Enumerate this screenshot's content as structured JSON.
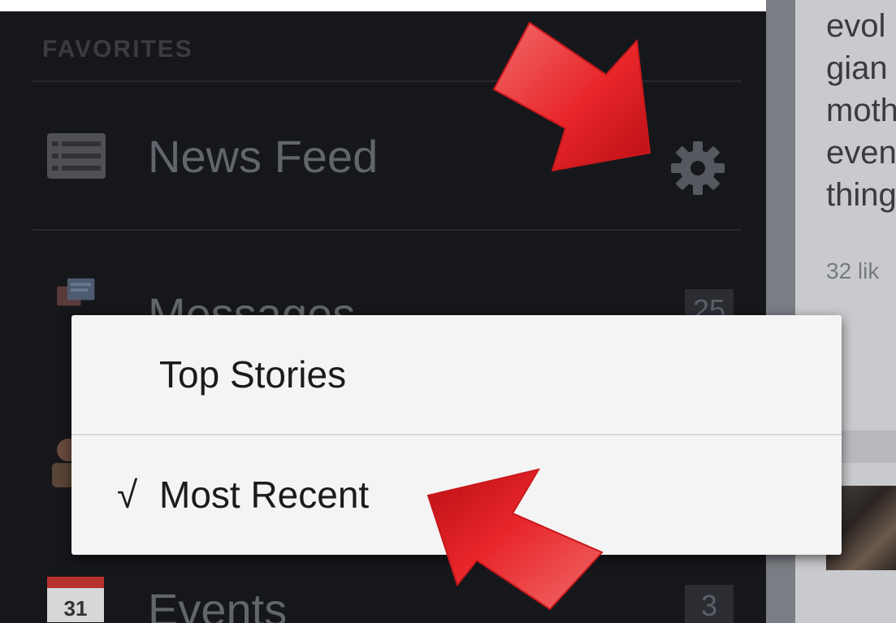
{
  "drawer": {
    "section_header": "FAVORITES",
    "items": [
      {
        "label": "News Feed",
        "icon": "news-feed-icon",
        "count": ""
      },
      {
        "label": "Messages",
        "icon": "messages-icon",
        "count": "25"
      },
      {
        "label": "Events",
        "icon": "calendar-icon",
        "icon_text": "31",
        "count": "3"
      }
    ],
    "settings_icon": "gear-icon"
  },
  "popup_menu": {
    "items": [
      {
        "label": "Top Stories",
        "checked": false
      },
      {
        "label": "Most Recent",
        "checked": true,
        "check_glyph": "√"
      }
    ]
  },
  "content": {
    "lines": [
      "evol",
      "gian",
      "moth",
      "even",
      "thing"
    ],
    "likes": "32 lik"
  },
  "colors": {
    "drawer_bg": "#16171b",
    "popup_bg": "#f4f4f4",
    "annotation_arrow": "#e8262a"
  }
}
